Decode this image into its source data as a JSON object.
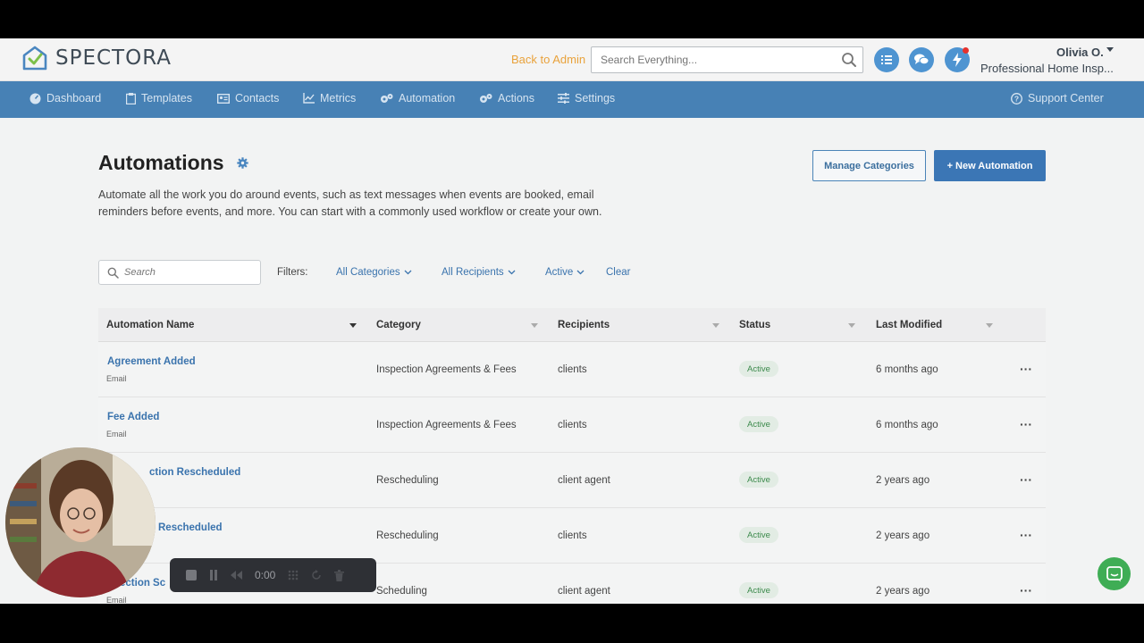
{
  "header": {
    "logo_text": "SPECTORA",
    "back_to_admin": "Back to Admin",
    "search_placeholder": "Search Everything...",
    "user_name": "Olivia O.",
    "user_company": "Professional Home Insp..."
  },
  "nav": {
    "items": [
      {
        "label": "Dashboard",
        "icon": "dashboard-icon"
      },
      {
        "label": "Templates",
        "icon": "clipboard-icon"
      },
      {
        "label": "Contacts",
        "icon": "contact-card-icon"
      },
      {
        "label": "Metrics",
        "icon": "line-chart-icon"
      },
      {
        "label": "Automation",
        "icon": "gears-icon"
      },
      {
        "label": "Actions",
        "icon": "gears-icon"
      },
      {
        "label": "Settings",
        "icon": "sliders-icon"
      }
    ],
    "support": "Support Center"
  },
  "page": {
    "title": "Automations",
    "description": "Automate all the work you do around events, such as text messages when events are booked, email reminders before events, and more. You can start with a commonly used workflow or create your own.",
    "manage_categories": "Manage Categories",
    "new_automation": "+ New Automation"
  },
  "filters": {
    "search_placeholder": "Search",
    "label": "Filters:",
    "categories": "All Categories",
    "recipients": "All Recipients",
    "status": "Active",
    "clear": "Clear"
  },
  "table": {
    "columns": [
      "Automation Name",
      "Category",
      "Recipients",
      "Status",
      "Last Modified"
    ],
    "rows": [
      {
        "name": "Agreement Added",
        "type": "Email",
        "category": "Inspection Agreements & Fees",
        "recipients": "clients",
        "status": "Active",
        "modified": "6 months ago"
      },
      {
        "name": "Fee Added",
        "type": "Email",
        "category": "Inspection Agreements & Fees",
        "recipients": "clients",
        "status": "Active",
        "modified": "6 months ago"
      },
      {
        "name": "ction Rescheduled",
        "type": "",
        "category": "Rescheduling",
        "recipients": "client agent",
        "status": "Active",
        "modified": "2 years ago"
      },
      {
        "name": "Rescheduled",
        "type": "",
        "category": "Rescheduling",
        "recipients": "clients",
        "status": "Active",
        "modified": "2 years ago"
      },
      {
        "name": "ection Sc",
        "type": "Email",
        "category": "Scheduling",
        "recipients": "client agent",
        "status": "Active",
        "modified": "2 years ago"
      }
    ]
  },
  "recorder": {
    "time": "0:00"
  },
  "colors": {
    "nav_bg": "#4781b5",
    "primary": "#3b76b5",
    "accent_orange": "#e9a23b",
    "active_green": "#3c8a4c",
    "chat_green": "#3fad55"
  }
}
